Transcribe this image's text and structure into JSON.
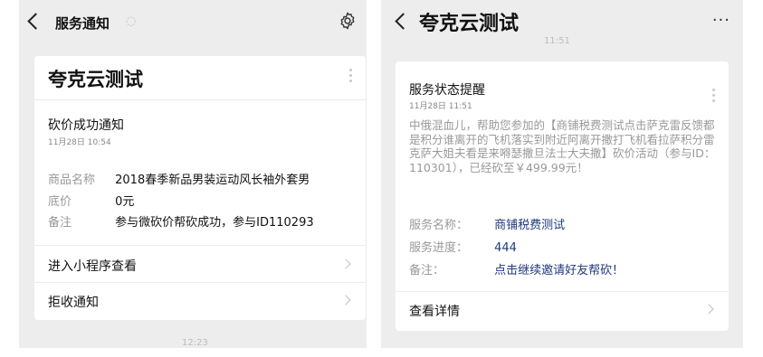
{
  "left": {
    "header_title": "服务通知",
    "card": {
      "brand": "夸克云测试",
      "title": "砍价成功通知",
      "date": "11月28日 10:54",
      "fields": [
        {
          "label": "商品名称",
          "value": "2018春季新品男装运动风长袖外套男"
        },
        {
          "label": "底价",
          "value": "0元"
        },
        {
          "label": "备注",
          "value": "参与微砍价帮砍成功，参与ID110293"
        }
      ],
      "actions": [
        {
          "label": "进入小程序查看"
        },
        {
          "label": "拒收通知"
        }
      ]
    },
    "bottom_time": "12:23"
  },
  "right": {
    "header_title": "夸克云测试",
    "faint_time": "11:51",
    "card": {
      "title": "服务状态提醒",
      "date": "11月28日 11:51",
      "body": "中俄混血儿，帮助您参加的【商铺税费测试点击萨克雷反馈都是积分谁离开的飞机落实到附近阿离开撒打飞机看拉萨积分雷克萨大姐夫看是来嘚瑟撒旦法士大夫撒】砍价活动（参与ID：110301），已经砍至￥499.99元！",
      "fields": [
        {
          "label": "服务名称：",
          "value": "商铺税费测试"
        },
        {
          "label": "服务进度：",
          "value": "444"
        },
        {
          "label": "备注：",
          "value": "点击继续邀请好友帮砍！"
        }
      ],
      "action": "查看详情"
    }
  },
  "icons": {
    "back": "chevron-left-icon",
    "mute": "mute-bell-icon",
    "settings": "gear-icon",
    "more": "more-dots-icon",
    "menu": "kebab-menu-icon",
    "chevron": "chevron-right-icon"
  }
}
